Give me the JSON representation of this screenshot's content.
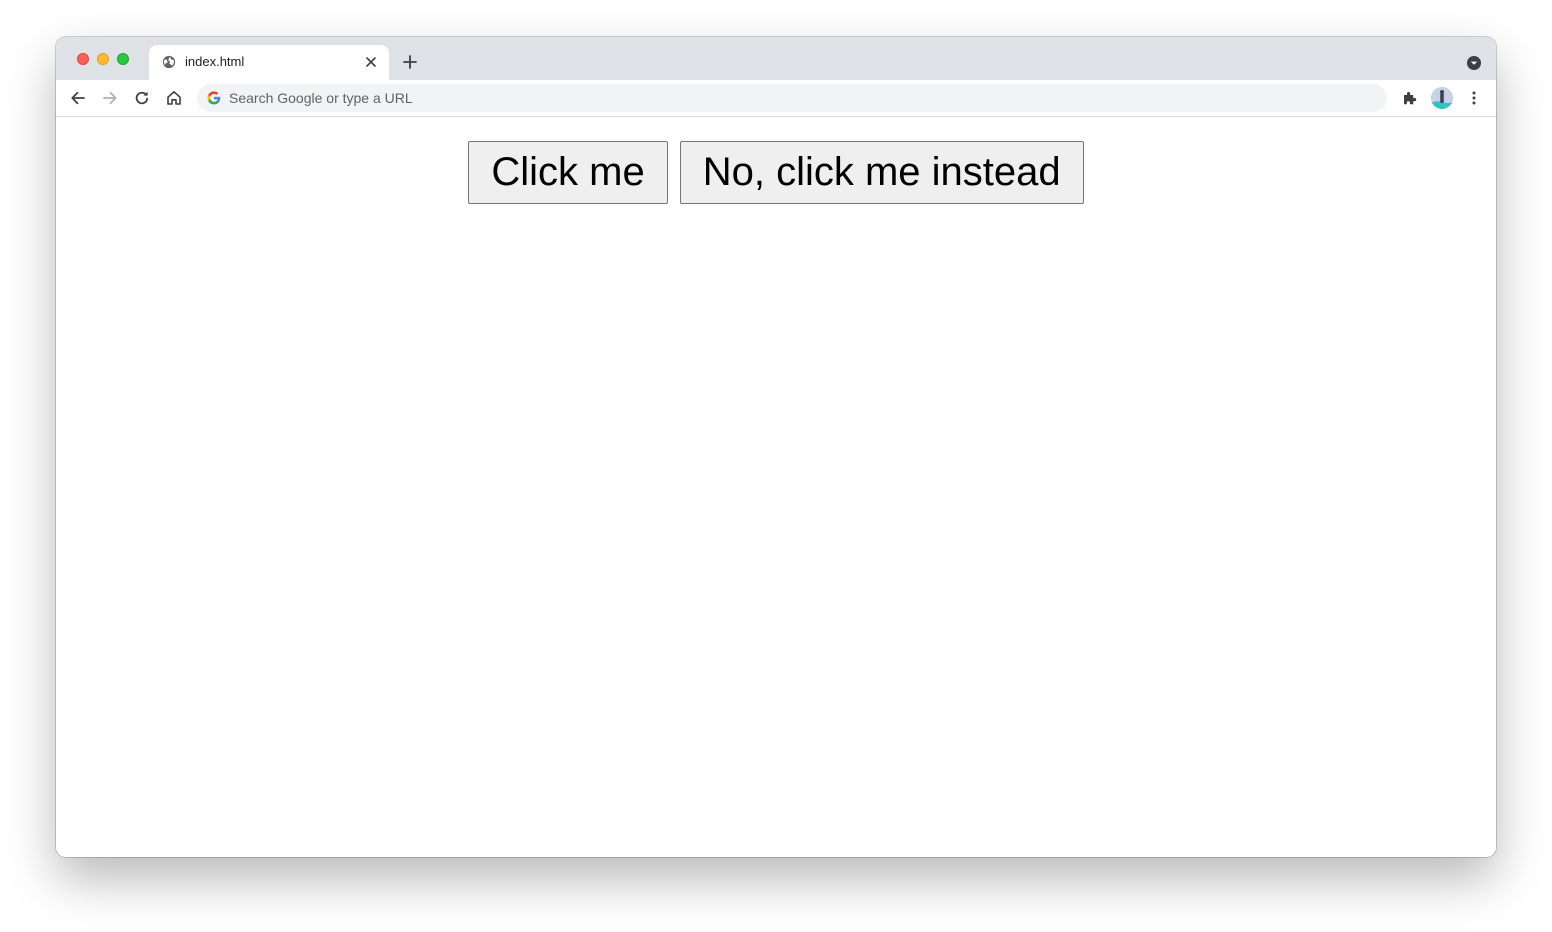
{
  "browser": {
    "tab": {
      "title": "index.html"
    },
    "omnibox": {
      "placeholder": "Search Google or type a URL",
      "value": ""
    },
    "colors": {
      "tabstrip": "#dee1e6",
      "traffic_close": "#ff5f57",
      "traffic_minimize": "#febc2e",
      "traffic_maximize": "#28c840"
    }
  },
  "page": {
    "buttons": [
      {
        "label": "Click me"
      },
      {
        "label": "No, click me instead"
      }
    ]
  }
}
